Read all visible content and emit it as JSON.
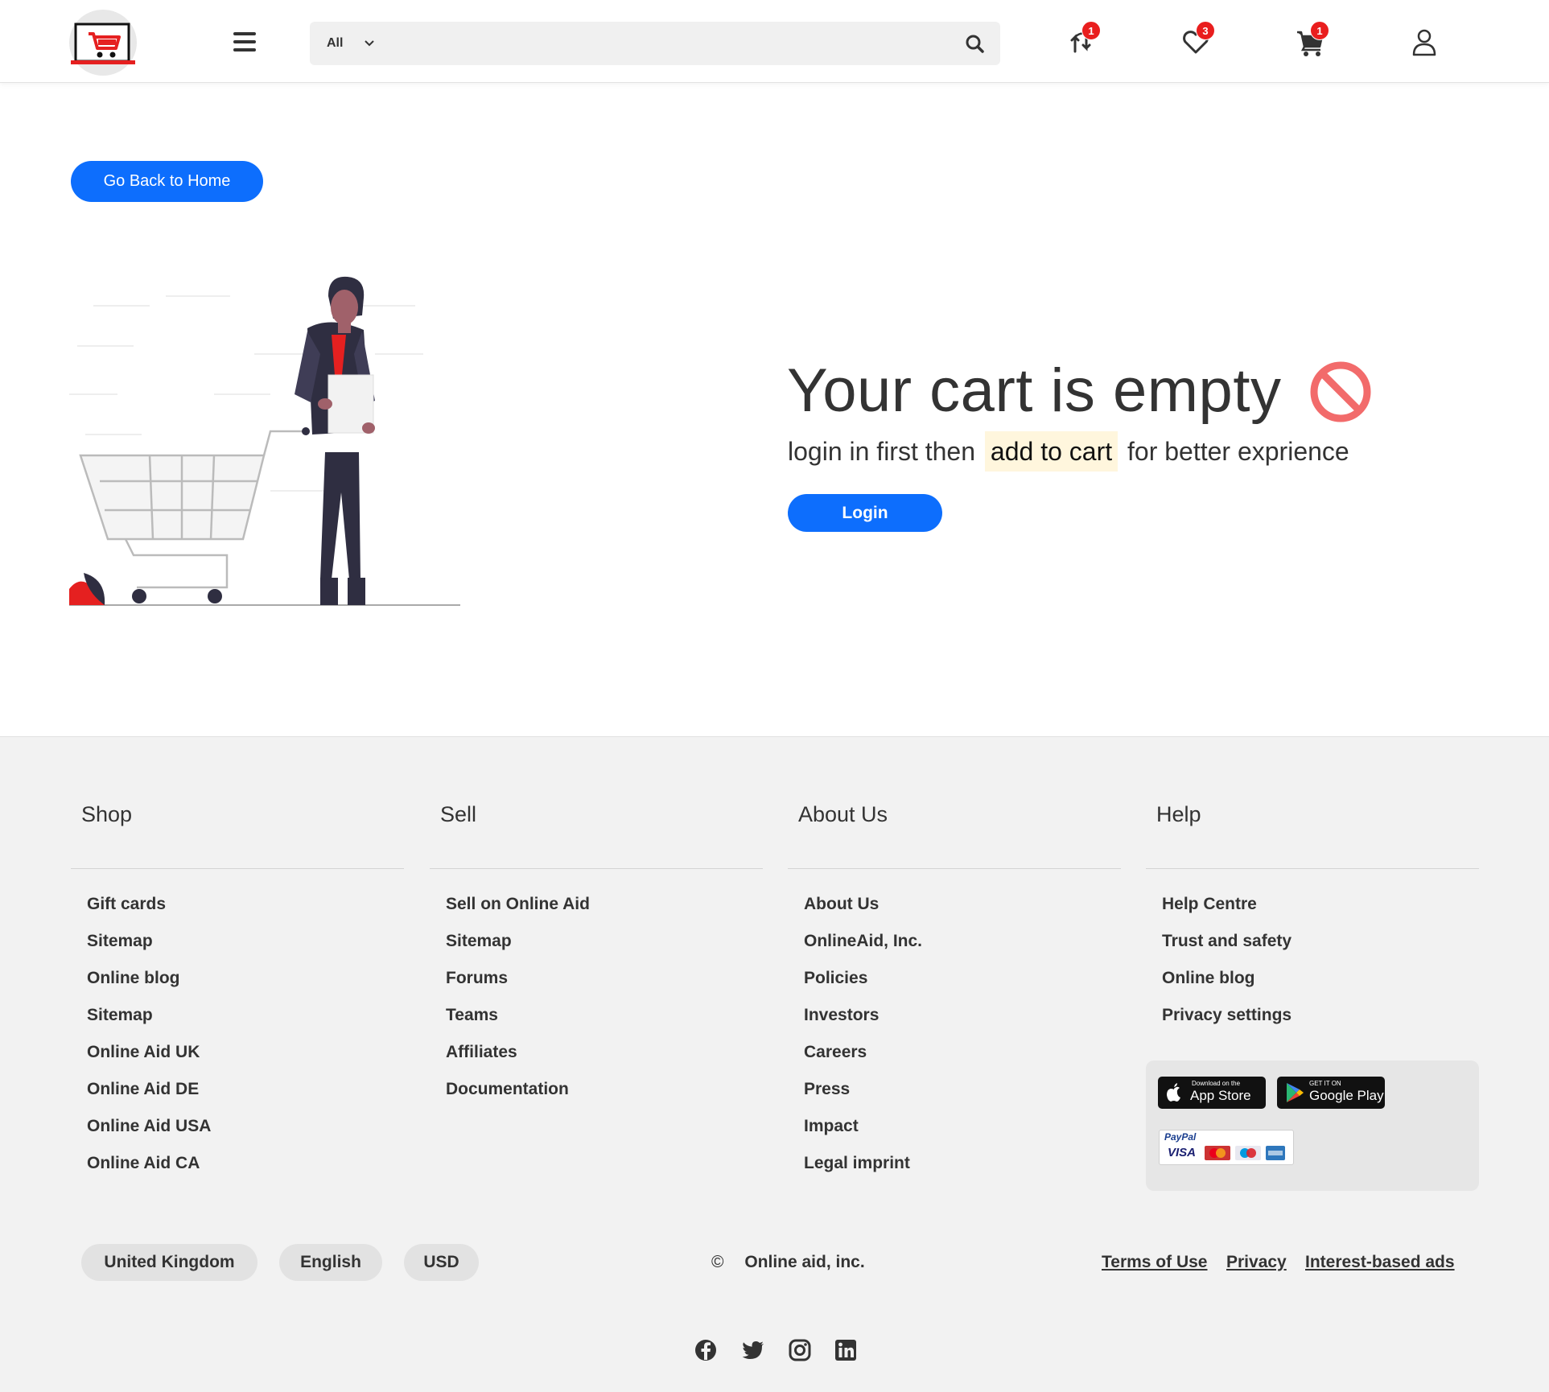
{
  "header": {
    "search": {
      "category": "All",
      "placeholder": ""
    },
    "badges": {
      "compare": "1",
      "wishlist": "3",
      "cart": "1"
    },
    "icons": [
      "logo",
      "menu-icon",
      "chevron-down-icon",
      "search-icon",
      "compare-icon",
      "heart-icon",
      "cart-icon",
      "user-icon"
    ]
  },
  "main": {
    "back_button": "Go Back to Home",
    "title": "Your cart is empty",
    "subtitle_before": "login in first then",
    "subtitle_highlight": "add to cart",
    "subtitle_after": "for better exprience",
    "login_button": "Login"
  },
  "footer": {
    "columns": [
      {
        "title": "Shop",
        "links": [
          "Gift cards",
          "Sitemap",
          "Online blog",
          "Sitemap",
          "Online Aid UK",
          "Online Aid DE",
          "Online Aid USA",
          "Online Aid CA"
        ]
      },
      {
        "title": "Sell",
        "links": [
          "Sell on Online Aid",
          "Sitemap",
          "Forums",
          "Teams",
          "Affiliates",
          "Documentation"
        ]
      },
      {
        "title": "About Us",
        "links": [
          "About Us",
          "OnlineAid, Inc.",
          "Policies",
          "Investors",
          "Careers",
          "Press",
          "Impact",
          "Legal imprint"
        ]
      },
      {
        "title": "Help",
        "links": [
          "Help Centre",
          "Trust and safety",
          "Online blog",
          "Privacy settings"
        ]
      }
    ],
    "app_store": {
      "small": "Download on the",
      "big": "App Store"
    },
    "google_play": {
      "small": "GET IT ON",
      "big": "Google Play"
    },
    "payment_text": {
      "paypal": "PayPal",
      "visa": "VISA"
    },
    "region": "United Kingdom",
    "language": "English",
    "currency": "USD",
    "copyright_symbol": "©",
    "copyright": "Online aid, inc.",
    "legal_links": [
      "Terms of Use",
      "Privacy",
      "Interest-based ads"
    ],
    "social": [
      "facebook-icon",
      "twitter-icon",
      "instagram-icon",
      "linkedin-icon"
    ]
  },
  "colors": {
    "primary": "#0d6efd",
    "badge": "#e91e1e",
    "brand_red": "#e52020",
    "footer_bg": "#f2f2f2",
    "highlight": "#fff6dd"
  }
}
